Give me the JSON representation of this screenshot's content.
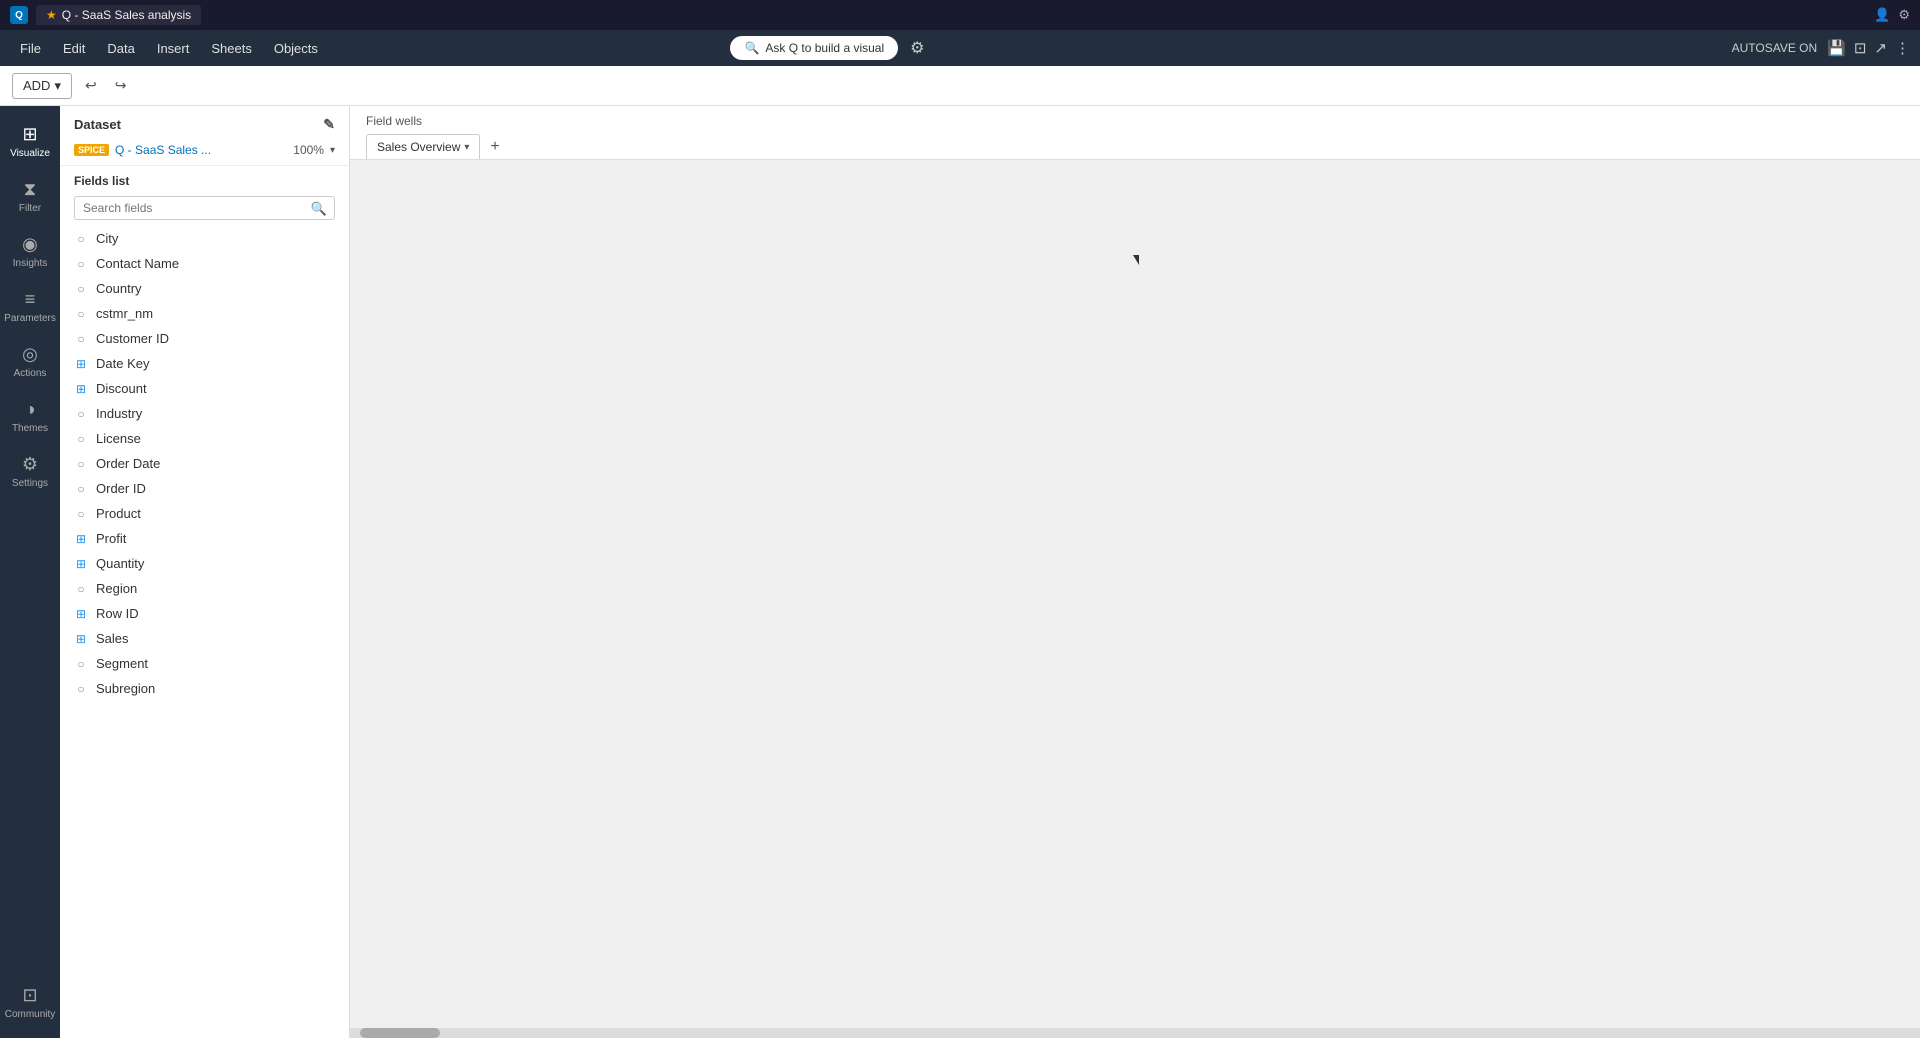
{
  "titleBar": {
    "logoText": "Q",
    "tabTitle": "Q - SaaS Sales analysis",
    "starIcon": "★"
  },
  "menuBar": {
    "items": [
      "File",
      "Edit",
      "Data",
      "Insert",
      "Sheets",
      "Objects"
    ],
    "askQLabel": "Ask Q to build a visual",
    "autosaveLabel": "AUTOSAVE ON"
  },
  "toolbar": {
    "addLabel": "ADD",
    "addChevron": "▾",
    "undoIcon": "↩",
    "redoIcon": "↪"
  },
  "sidebar": {
    "items": [
      {
        "id": "visualize",
        "label": "Visualize",
        "icon": "⊞",
        "active": true
      },
      {
        "id": "filter",
        "label": "Filter",
        "icon": "⧖"
      },
      {
        "id": "insights",
        "label": "Insights",
        "icon": "◉"
      },
      {
        "id": "parameters",
        "label": "Parameters",
        "icon": "⊞"
      },
      {
        "id": "actions",
        "label": "Actions",
        "icon": "◎"
      },
      {
        "id": "themes",
        "label": "Themes",
        "icon": "◎"
      },
      {
        "id": "settings",
        "label": "Settings",
        "icon": "⚙"
      }
    ],
    "communityItem": {
      "id": "community",
      "label": "Community",
      "icon": "⊡"
    }
  },
  "fieldsPanel": {
    "datasetLabel": "Dataset",
    "editIcon": "✎",
    "spiceBadge": "SPICE",
    "datasetName": "Q - SaaS Sales ...",
    "datasetPct": "100%",
    "fieldsListLabel": "Fields list",
    "searchPlaceholder": "Search fields",
    "fields": [
      {
        "name": "City",
        "type": "geo"
      },
      {
        "name": "Contact Name",
        "type": "string"
      },
      {
        "name": "Country",
        "type": "geo"
      },
      {
        "name": "cstmr_nm",
        "type": "string"
      },
      {
        "name": "Customer ID",
        "type": "string"
      },
      {
        "name": "Date Key",
        "type": "numeric"
      },
      {
        "name": "Discount",
        "type": "numeric"
      },
      {
        "name": "Industry",
        "type": "string"
      },
      {
        "name": "License",
        "type": "string"
      },
      {
        "name": "Order Date",
        "type": "date"
      },
      {
        "name": "Order ID",
        "type": "string"
      },
      {
        "name": "Product",
        "type": "string"
      },
      {
        "name": "Profit",
        "type": "numeric"
      },
      {
        "name": "Quantity",
        "type": "numeric"
      },
      {
        "name": "Region",
        "type": "geo"
      },
      {
        "name": "Row ID",
        "type": "numeric"
      },
      {
        "name": "Sales",
        "type": "numeric"
      },
      {
        "name": "Segment",
        "type": "string"
      },
      {
        "name": "Subregion",
        "type": "string"
      }
    ]
  },
  "canvas": {
    "fieldWellsTitle": "Field wells",
    "sheetTabLabel": "Sales Overview",
    "addSheetIcon": "+"
  },
  "fieldTypeIcons": {
    "geo": "○",
    "string": "○",
    "numeric": "⊞",
    "date": "○"
  },
  "fieldTypeColors": {
    "geo": "#888888",
    "string": "#888888",
    "numeric": "#2196f3",
    "date": "#888888"
  }
}
